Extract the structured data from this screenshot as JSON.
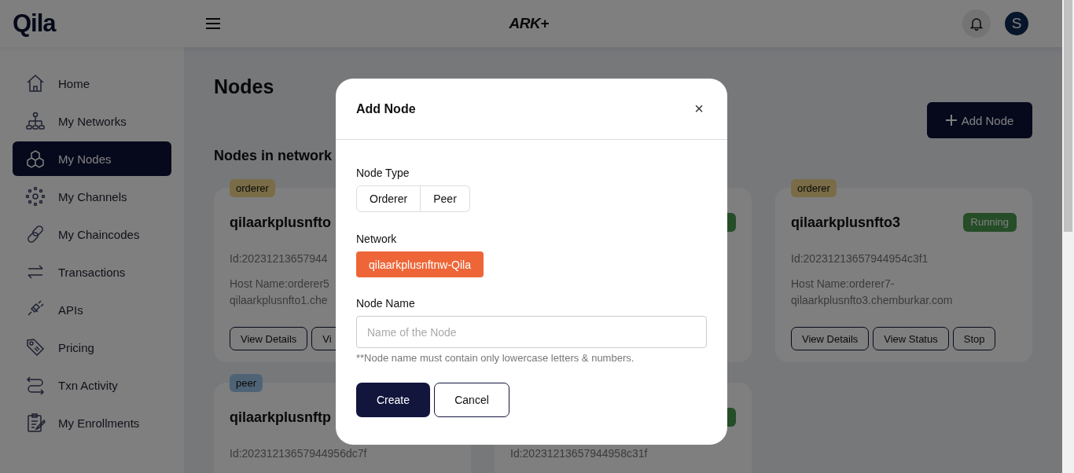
{
  "header": {
    "logo": "Qila",
    "brand": "ARK+",
    "avatar": "S"
  },
  "sidebar": {
    "items": [
      {
        "label": "Home",
        "selected": false
      },
      {
        "label": "My Networks",
        "selected": false
      },
      {
        "label": "My Nodes",
        "selected": true
      },
      {
        "label": "My Channels",
        "selected": false
      },
      {
        "label": "My Chaincodes",
        "selected": false
      },
      {
        "label": "Transactions",
        "selected": false
      },
      {
        "label": "APIs",
        "selected": false
      },
      {
        "label": "Pricing",
        "selected": false
      },
      {
        "label": "Txn Activity",
        "selected": false
      },
      {
        "label": "My Enrollments",
        "selected": false
      }
    ]
  },
  "page": {
    "title": "Nodes",
    "add_button": "Add Node",
    "section_title": "Nodes in network"
  },
  "cards": [
    {
      "type": "orderer",
      "name": "qilaarkplusnfto",
      "id": "Id:20231213657944",
      "host": [
        "Host Name:orderer5",
        "qilaarkplusnfto1.che"
      ],
      "buttons": [
        "View Details",
        "Vi"
      ]
    },
    {
      "running": true
    },
    {
      "type": "orderer",
      "running": true,
      "name": "qilaarkplusnfto3",
      "status": "Running",
      "id": "Id:20231213657944954c3f1",
      "host": [
        "Host Name:orderer7-",
        "qilaarkplusnfto3.chemburkar.com"
      ],
      "buttons": [
        "View Details",
        "View Status",
        "Stop"
      ]
    },
    {
      "type": "peer",
      "name": "qilaarkplusnftp",
      "id": "Id:20231213657944956dc7f"
    },
    {
      "running": true,
      "id": "Id:20231213657944958c31f"
    }
  ],
  "modal": {
    "title": "Add Node",
    "close": "×",
    "node_type_label": "Node Type",
    "node_types": [
      {
        "label": "Orderer",
        "selected": false
      },
      {
        "label": "Peer",
        "selected": false
      }
    ],
    "network_label": "Network",
    "network": "qilaarkplusnftnw-Qila",
    "node_name_label": "Node Name",
    "node_name_placeholder": "Name of the Node",
    "hint": "**Node name must contain only lowercase letters & numbers.",
    "create": "Create",
    "cancel": "Cancel"
  }
}
